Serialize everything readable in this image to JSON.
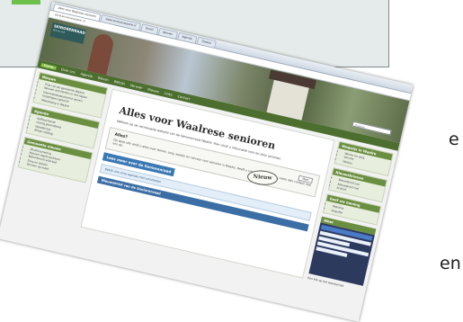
{
  "side_text": [
    "e",
    "en"
  ],
  "browser": {
    "tabs": [
      "Alles voor Waalrese senioren",
      "www.seniorenwaalre.nl",
      "Gmail",
      "Nieuws",
      "Agenda",
      "Zoeken"
    ],
    "address": "www.seniorenwaalre.nl"
  },
  "header": {
    "logo_line1": "SENIORENRAAD",
    "logo_line2": "WAALRE",
    "search_placeholder": "Zoeken"
  },
  "nav": [
    "Home",
    "Over ons",
    "Agenda",
    "Wonen",
    "Welzijn",
    "Vervoer",
    "Nieuws",
    "Links",
    "Contact"
  ],
  "left_blocks": [
    {
      "title": "Nieuws",
      "items": [
        "Prijs van de gemeente Waalre",
        "Nieuwe activiteiten in het najaar",
        "Informatiebijeenkomst wonen",
        "Vrijwilligers gezocht",
        "Mantelzorg in Waalre"
      ]
    },
    {
      "title": "Agenda",
      "items": [
        "Koffieochtend",
        "Lezing gezondheid",
        "Wandelclub",
        "Bingo middag"
      ]
    },
    {
      "title": "Gemeente nieuws",
      "items": [
        "Afvalinzameling",
        "Nieuwe regels parkeren",
        "Bijeenkomst wijkraad",
        "Zorg en welzijn",
        "Vervoer op maat"
      ]
    }
  ],
  "main": {
    "title": "Alles voor Waalrese senioren",
    "intro": "Welkom op de vernieuwde website van de Seniorenraad Waalre. Hier vindt u informatie voor en door senioren.",
    "box_title": "Allez?",
    "box_pill": "Meer",
    "box_text": "Op deze site vindt u alles over wonen, zorg, welzijn en vervoer voor senioren in Waalre. Heeft u vragen of suggesties, neem dan contact met ons op.",
    "badge": "Nieuw",
    "cta": "Lees meer over de Seniorenraad",
    "info": "Bekijk ook onze agenda met activiteiten",
    "news": "Nieuwsbrief van de Seniorenraad"
  },
  "right_blocks": [
    {
      "title": "Wegwijs in Waalre",
      "items": [
        "Wonen en zorg",
        "Vervoer",
        "Welzijn"
      ]
    },
    {
      "title": "Nieuwsbrieven",
      "items": [
        "Nieuwsbrief juni",
        "Nieuwsbrief mei",
        "Archief"
      ]
    },
    {
      "title": "Geef uw mening",
      "items": [
        "Reacties",
        "Enquête"
      ]
    }
  ],
  "widget_title": "Weer",
  "widget_label": "Een klik op het weerbericht"
}
